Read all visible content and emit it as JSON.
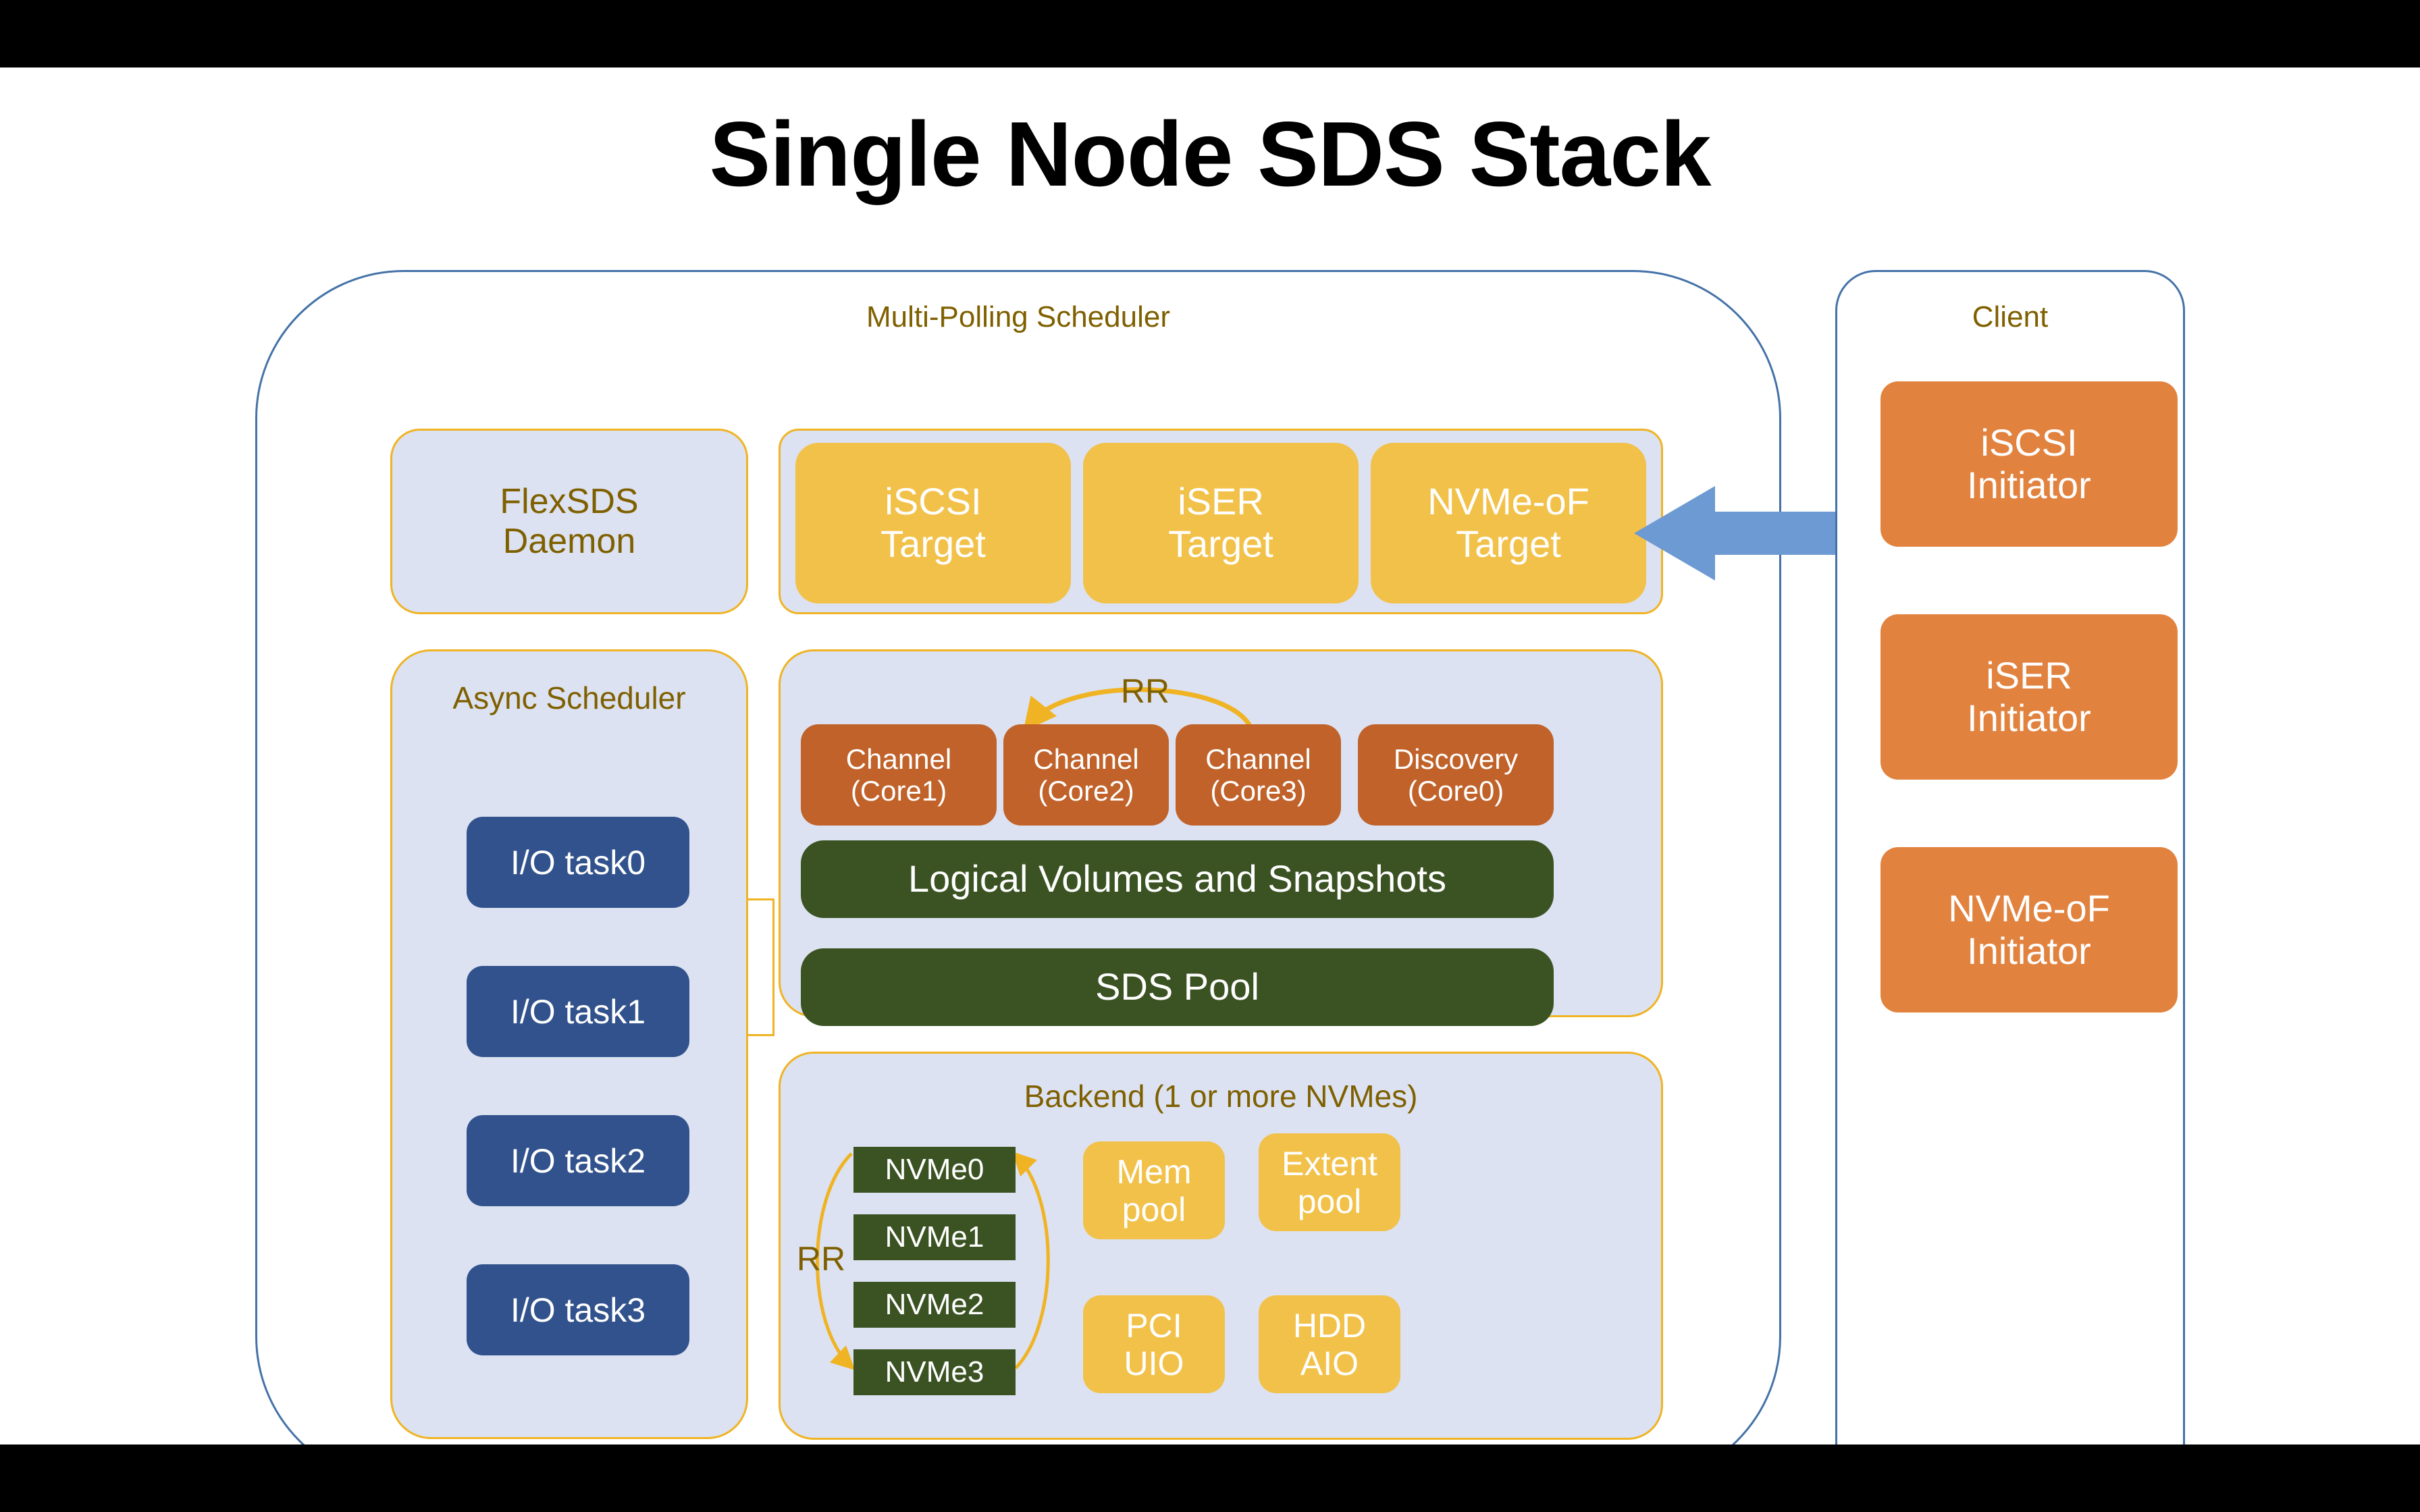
{
  "title": "Single Node SDS Stack",
  "colors": {
    "panel_fill": "#dce2f1",
    "panel_border": "#f0b323",
    "outer_border": "#4472a8",
    "amber": "#f2c14a",
    "brick": "#c0622a",
    "green": "#3b5323",
    "navy": "#31528c",
    "orange": "#e2823f",
    "label_brown": "#7f6000",
    "arrow_blue": "#6d9ad2",
    "rr_arrow": "#f0b323"
  },
  "server": {
    "title": "Multi-Polling Scheduler",
    "daemon_panel": {
      "label": "FlexSDS\nDaemon"
    },
    "targets_panel": {
      "items": [
        {
          "label": "iSCSI\nTarget"
        },
        {
          "label": "iSER\nTarget"
        },
        {
          "label": "NVMe-oF\nTarget"
        }
      ]
    },
    "async_panel": {
      "title": "Async Scheduler",
      "tasks": [
        {
          "label": "I/O task0"
        },
        {
          "label": "I/O task1"
        },
        {
          "label": "I/O task2"
        },
        {
          "label": "I/O task3"
        }
      ]
    },
    "core_panel": {
      "rr_label": "RR",
      "cores": [
        {
          "label": "Channel\n(Core1)"
        },
        {
          "label": "Channel\n(Core2)"
        },
        {
          "label": "Channel\n(Core3)"
        },
        {
          "label": "Discovery\n(Core0)"
        }
      ],
      "layers": [
        {
          "label": "Logical Volumes and Snapshots"
        },
        {
          "label": "SDS Pool"
        }
      ]
    },
    "backend_panel": {
      "title": "Backend (1 or more NVMes)",
      "rr_label": "RR",
      "nvmes": [
        {
          "label": "NVMe0"
        },
        {
          "label": "NVMe1"
        },
        {
          "label": "NVMe2"
        },
        {
          "label": "NVMe3"
        }
      ],
      "pools": [
        {
          "label": "Mem\npool"
        },
        {
          "label": "Extent\npool"
        },
        {
          "label": "PCI\nUIO"
        },
        {
          "label": "HDD\nAIO"
        }
      ]
    }
  },
  "client": {
    "title": "Client",
    "initiators": [
      {
        "label": "iSCSI\nInitiator"
      },
      {
        "label": "iSER\nInitiator"
      },
      {
        "label": "NVMe-oF\nInitiator"
      }
    ]
  }
}
